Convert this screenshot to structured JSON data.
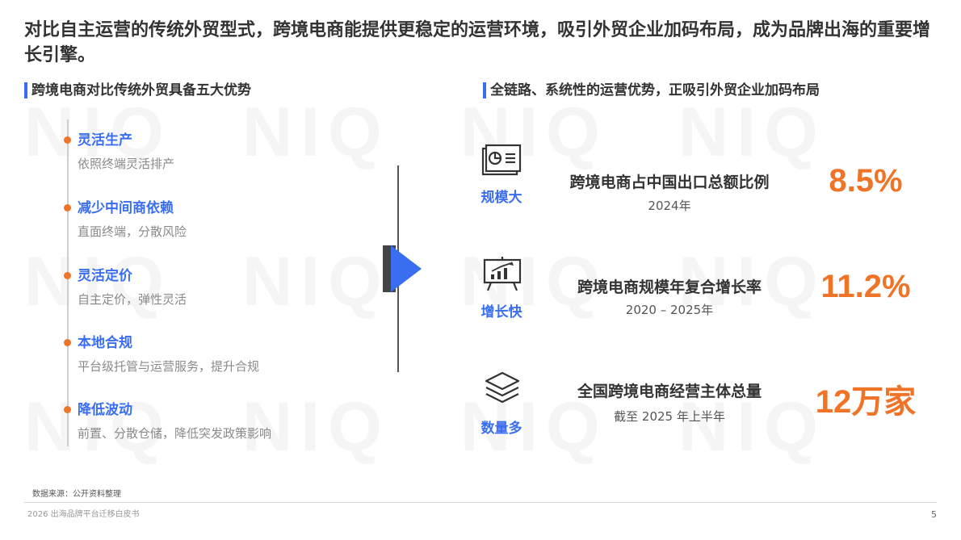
{
  "watermark_text": "NIQ",
  "headline": "对比自主运营的传统外贸型式，跨境电商能提供更稳定的运营环境，吸引外贸企业加码布局，成为品牌出海的重要增长引擎。",
  "left_section": {
    "title": "跨境电商对比传统外贸具备五大优势",
    "advantages": [
      {
        "title": "灵活生产",
        "desc": "依照终端灵活排产"
      },
      {
        "title": "减少中间商依赖",
        "desc": "直面终端，分散风险"
      },
      {
        "title": "灵活定价",
        "desc": "自主定价，弹性灵活"
      },
      {
        "title": "本地合规",
        "desc": "平台级托管与运营服务，提升合规"
      },
      {
        "title": "降低波动",
        "desc": "前置、分散仓储，降低突发政策影响"
      }
    ]
  },
  "right_section": {
    "title": "全链路、系统性的运营优势，正吸引外贸企业加码布局",
    "metrics": [
      {
        "icon": "presentation-chart-icon",
        "label": "规模大",
        "title": "跨境电商占中国出口总额比例",
        "sub": "2024年",
        "value": "8.5%"
      },
      {
        "icon": "growth-board-icon",
        "label": "增长快",
        "title": "跨境电商规模年复合增长率",
        "sub": "2020 – 2025年",
        "value": "11.2%"
      },
      {
        "icon": "layers-icon",
        "label": "数量多",
        "title": "全国跨境电商经营主体总量",
        "sub": "截至 2025 年上半年",
        "value": "12万家"
      }
    ]
  },
  "colors": {
    "accent_blue": "#3a6ef0",
    "accent_orange": "#f07427",
    "text_dark": "#333333",
    "text_gray": "#8a8a8a"
  },
  "source": "数据来源：公开资料整理",
  "footer": "2026 出海品牌平台迁移白皮书",
  "page_number": "5"
}
